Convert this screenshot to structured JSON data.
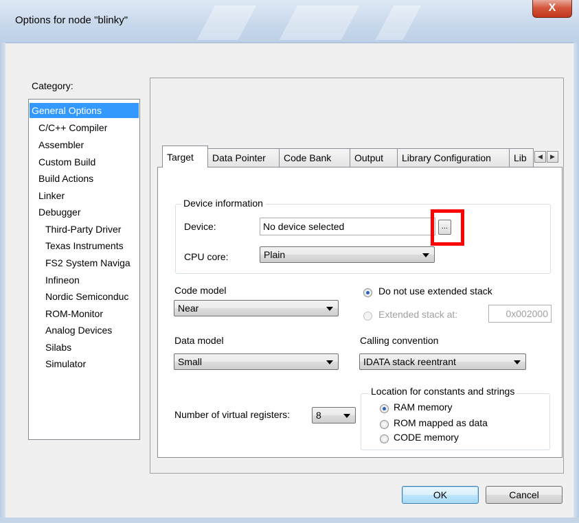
{
  "window": {
    "title": "Options for node \"blinky\"",
    "close_glyph": "X"
  },
  "category": {
    "label": "Category:",
    "items": [
      {
        "label": "General Options",
        "selected": true,
        "indent": 0
      },
      {
        "label": "C/C++ Compiler",
        "selected": false,
        "indent": 1
      },
      {
        "label": "Assembler",
        "selected": false,
        "indent": 1
      },
      {
        "label": "Custom Build",
        "selected": false,
        "indent": 1
      },
      {
        "label": "Build Actions",
        "selected": false,
        "indent": 1
      },
      {
        "label": "Linker",
        "selected": false,
        "indent": 1
      },
      {
        "label": "Debugger",
        "selected": false,
        "indent": 1
      },
      {
        "label": "Third-Party Driver",
        "selected": false,
        "indent": 2
      },
      {
        "label": "Texas Instruments",
        "selected": false,
        "indent": 2
      },
      {
        "label": "FS2 System Naviga",
        "selected": false,
        "indent": 2
      },
      {
        "label": "Infineon",
        "selected": false,
        "indent": 2
      },
      {
        "label": "Nordic Semiconduc",
        "selected": false,
        "indent": 2
      },
      {
        "label": "ROM-Monitor",
        "selected": false,
        "indent": 2
      },
      {
        "label": "Analog Devices",
        "selected": false,
        "indent": 2
      },
      {
        "label": "Silabs",
        "selected": false,
        "indent": 2
      },
      {
        "label": "Simulator",
        "selected": false,
        "indent": 2
      }
    ]
  },
  "tabs": {
    "items": [
      {
        "label": "Target",
        "active": true
      },
      {
        "label": "Data Pointer",
        "active": false
      },
      {
        "label": "Code Bank",
        "active": false
      },
      {
        "label": "Output",
        "active": false
      },
      {
        "label": "Library Configuration",
        "active": false
      },
      {
        "label": "Lib",
        "active": false
      }
    ],
    "scroll_left": "◀",
    "scroll_right": "▶"
  },
  "device_info": {
    "group_title": "Device information",
    "device_label": "Device:",
    "device_value": "No device selected",
    "browse_label": "...",
    "cpu_label": "CPU core:",
    "cpu_value": "Plain"
  },
  "code_model": {
    "label": "Code model",
    "value": "Near"
  },
  "data_model": {
    "label": "Data model",
    "value": "Small"
  },
  "stack": {
    "no_extended_label": "Do not use extended stack",
    "extended_label": "Extended stack at:",
    "extended_value": "0x002000",
    "selected": "no_extended"
  },
  "calling_convention": {
    "label": "Calling convention",
    "value": "IDATA stack reentrant"
  },
  "virtual_registers": {
    "label": "Number of virtual registers:",
    "value": "8"
  },
  "constants_location": {
    "title": "Location for constants and strings",
    "options": [
      {
        "label": "RAM memory",
        "checked": true
      },
      {
        "label": "ROM mapped as data",
        "checked": false
      },
      {
        "label": "CODE memory",
        "checked": false
      }
    ]
  },
  "buttons": {
    "ok": "OK",
    "cancel": "Cancel"
  },
  "colors": {
    "selection": "#3399ff",
    "highlight_box": "#ff0000",
    "radio_dot": "#2a62b8"
  }
}
